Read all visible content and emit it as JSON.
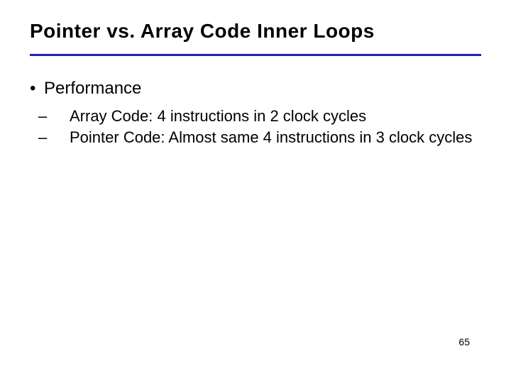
{
  "title": "Pointer vs. Array Code Inner Loops",
  "bullets": {
    "lvl1": {
      "marker": "•",
      "text": "Performance"
    },
    "lvl2": [
      {
        "marker": "–",
        "text": "Array Code: 4 instructions in 2 clock cycles"
      },
      {
        "marker": "–",
        "text": "Pointer Code: Almost same 4 instructions in 3 clock cycles"
      }
    ]
  },
  "page_number": "65"
}
